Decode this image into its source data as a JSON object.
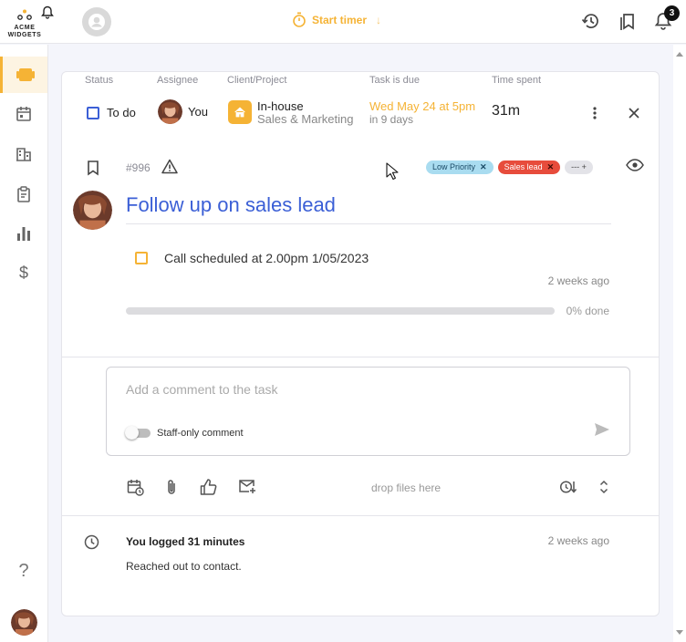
{
  "brand": {
    "logo_text": "ACME WIDGETS"
  },
  "topbar": {
    "start_timer": "Start timer",
    "start_timer_arrow": "↓",
    "notification_count": "3"
  },
  "task": {
    "columns": {
      "status": "Status",
      "assignee": "Assignee",
      "client": "Client/Project",
      "due": "Task is due",
      "time_spent": "Time spent"
    },
    "status": "To do",
    "assignee": "You",
    "client_name": "In-house",
    "client_project": "Sales & Marketing",
    "due_date": "Wed May 24 at 5pm",
    "due_relative": "in 9 days",
    "time_spent": "31m",
    "id": "#996",
    "tags": [
      {
        "label": "Low Priority",
        "color": "#a9dcf0"
      },
      {
        "label": "Sales lead",
        "color": "#e74c3c"
      }
    ],
    "tag_add": "--- +",
    "title": "Follow up on sales lead",
    "subtask": "Call scheduled at 2.00pm 1/05/2023",
    "subtask_time": "2 weeks ago",
    "progress_fraction": 0,
    "progress_label": "0% done"
  },
  "comment": {
    "placeholder": "Add a comment to the task",
    "staff_only_label": "Staff-only comment",
    "drop_files": "drop files here"
  },
  "log": {
    "title": "You logged 31 minutes",
    "time": "2 weeks ago",
    "body": "Reached out to contact."
  },
  "colors": {
    "accent": "#f5b335",
    "primary": "#3b5fd6",
    "danger": "#e74c3c"
  }
}
